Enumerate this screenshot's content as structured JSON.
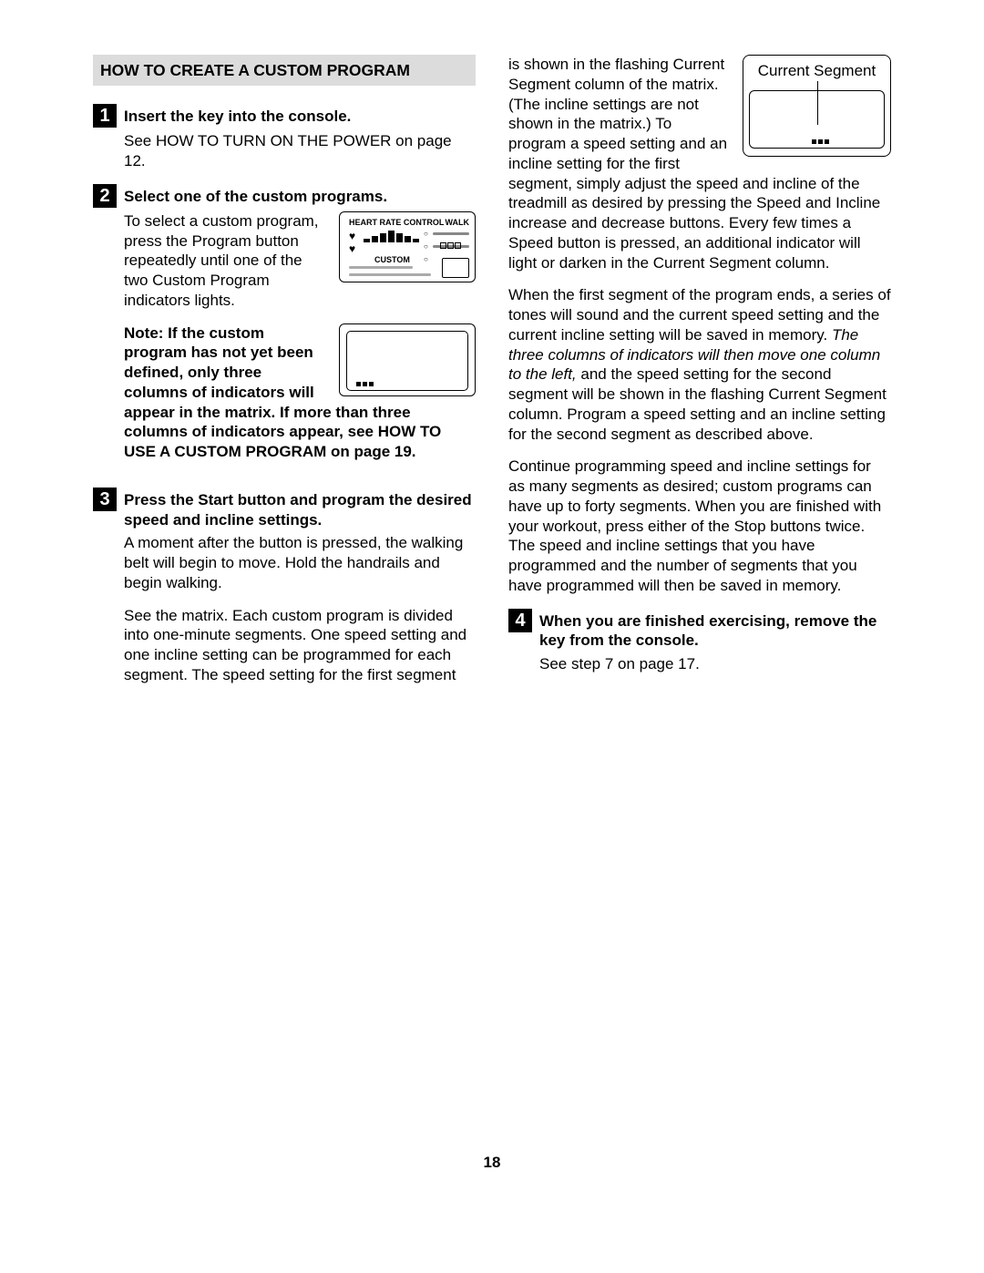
{
  "heading": "HOW TO CREATE A CUSTOM PROGRAM",
  "steps": {
    "s1": {
      "num": "1",
      "title": "Insert the key into the console.",
      "body": "See HOW TO TURN ON THE POWER on page 12."
    },
    "s2": {
      "num": "2",
      "title": "Select one of the custom programs.",
      "body": "To select a custom program, press the Program button repeatedly until one of the two Custom Program indicators lights.",
      "note": "Note: If the custom program has not yet been defined, only three columns of indicators will appear in the matrix. If more than three columns of indicators appear, see HOW TO USE A CUSTOM PROGRAM on page 19."
    },
    "s3": {
      "num": "3",
      "title": "Press the Start button and program the desired speed and incline settings.",
      "p1": "A moment after the button is pressed, the walking belt will begin to move. Hold the handrails and begin walking.",
      "p2a": "See the matrix. Each custom program is divided into one-minute segments. One speed setting and one incline setting can be programmed for each segment. The speed setting for the first segment",
      "p2b": "is shown in the flashing Current Segment column of the matrix. (The incline settings are not shown in the matrix.) To program a speed setting and an incline setting for the first segment, simply adjust the speed and incline of the treadmill as desired by pressing the Speed and Incline increase and decrease buttons. Every few times a Speed button is pressed, an additional indicator will light or darken in the Current Segment column.",
      "p3a": "When the first segment of the program ends, a series of tones will sound and the current speed setting and the current incline setting will be saved in memory. ",
      "p3i": "The three columns of indicators will then move one column to the left,",
      "p3b": " and the speed setting for the second segment will be shown in the flashing Current Segment column. Program a speed setting and an incline setting for the second segment as described above.",
      "p4": "Continue programming speed and incline settings for as many segments as desired; custom programs can have up to forty segments. When you are finished with your workout, press either of the Stop buttons twice. The speed and incline settings that you have programmed and the number of segments that you have programmed will then be saved in memory."
    },
    "s4": {
      "num": "4",
      "title": "When you are finished exercising, remove the key from the console.",
      "body": "See step 7 on page 17."
    }
  },
  "fig": {
    "seg_label": "Current Segment",
    "hr": "HEART RATE CONTROL",
    "walk": "WALK",
    "custom": "CUSTOM"
  },
  "page_number": "18"
}
